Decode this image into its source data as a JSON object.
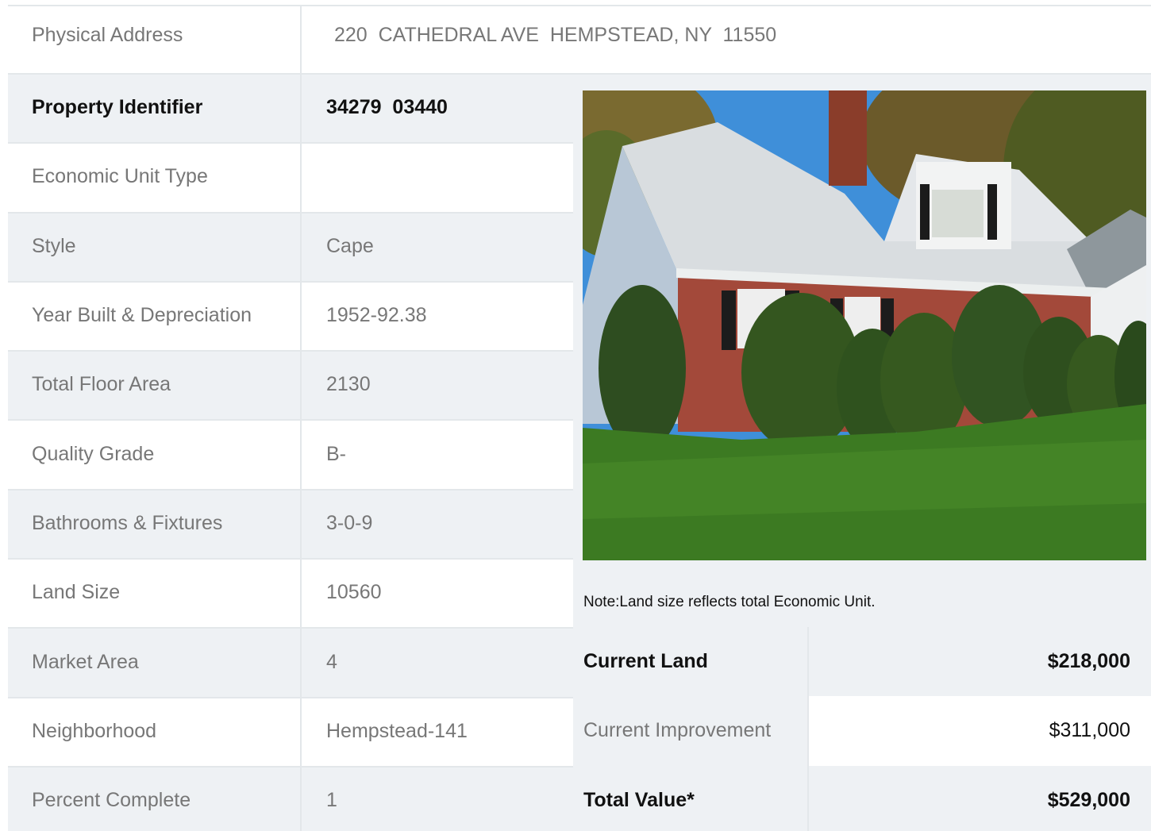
{
  "address": {
    "label": "Physical Address",
    "value": "220  CATHEDRAL AVE  HEMPSTEAD, NY  11550"
  },
  "details": [
    {
      "label": "Property Identifier",
      "value": "34279  03440"
    },
    {
      "label": "Economic Unit Type",
      "value": ""
    },
    {
      "label": "Style",
      "value": "Cape"
    },
    {
      "label": "Year Built & Depreciation",
      "value": "1952-92.38"
    },
    {
      "label": "Total Floor Area",
      "value": "2130"
    },
    {
      "label": "Quality Grade",
      "value": "B-"
    },
    {
      "label": "Bathrooms & Fixtures",
      "value": "3-0-9"
    },
    {
      "label": "Land Size",
      "value": "10560"
    },
    {
      "label": "Market Area",
      "value": "4"
    },
    {
      "label": "Neighborhood",
      "value": "Hempstead-141"
    },
    {
      "label": "Percent Complete",
      "value": "1"
    }
  ],
  "photo": {
    "icon": "house-photo"
  },
  "note": "Note:Land size reflects total Economic Unit.",
  "valuation": [
    {
      "label": "Current Land",
      "value": "$218,000"
    },
    {
      "label": "Current Improvement",
      "value": "$311,000"
    },
    {
      "label": "Total Value*",
      "value": "$529,000"
    }
  ],
  "colors": {
    "row_alt": "#eef1f4",
    "border": "#e3e7ea",
    "label_text": "#777777",
    "bold_text": "#111111"
  }
}
